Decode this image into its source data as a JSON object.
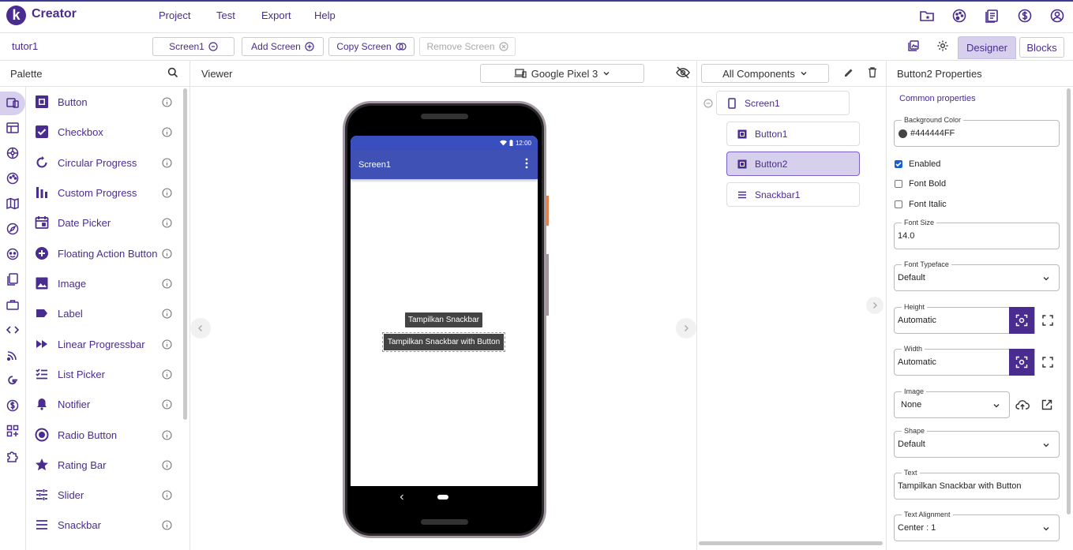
{
  "app": {
    "logo_letter": "k",
    "name": "Creator"
  },
  "menu": [
    "Project",
    "Test",
    "Export",
    "Help"
  ],
  "project": {
    "name": "tutor1"
  },
  "screen_bar": {
    "screen_select": "Screen1",
    "add_screen": "Add Screen",
    "copy_screen": "Copy Screen",
    "remove_screen": "Remove Screen",
    "designer": "Designer",
    "blocks": "Blocks"
  },
  "palette": {
    "title": "Palette",
    "items": [
      {
        "label": "Button",
        "icon": "button-icon"
      },
      {
        "label": "Checkbox",
        "icon": "checkbox-icon"
      },
      {
        "label": "Circular Progress",
        "icon": "circular-progress-icon"
      },
      {
        "label": "Custom Progress",
        "icon": "custom-progress-icon"
      },
      {
        "label": "Date Picker",
        "icon": "calendar-icon"
      },
      {
        "label": "Floating Action Button",
        "icon": "plus-circle-icon"
      },
      {
        "label": "Image",
        "icon": "image-icon"
      },
      {
        "label": "Label",
        "icon": "label-icon"
      },
      {
        "label": "Linear Progressbar",
        "icon": "fast-forward-icon"
      },
      {
        "label": "List Picker",
        "icon": "list-icon"
      },
      {
        "label": "Notifier",
        "icon": "bell-icon"
      },
      {
        "label": "Radio Button",
        "icon": "radio-icon"
      },
      {
        "label": "Rating Bar",
        "icon": "star-icon"
      },
      {
        "label": "Slider",
        "icon": "slider-icon"
      },
      {
        "label": "Snackbar",
        "icon": "snackbar-icon"
      }
    ]
  },
  "viewer": {
    "title": "Viewer",
    "device": "Google Pixel 3",
    "status_time": "12:00",
    "screen_title": "Screen1",
    "button1_text": "Tampilkan Snackbar",
    "button2_text": "Tampilkan Snackbar with Button"
  },
  "components": {
    "filter": "All Components",
    "tree": [
      {
        "label": "Screen1",
        "level": 0,
        "selected": false
      },
      {
        "label": "Button1",
        "level": 1,
        "selected": false
      },
      {
        "label": "Button2",
        "level": 1,
        "selected": true
      },
      {
        "label": "Snackbar1",
        "level": 1,
        "selected": false
      }
    ]
  },
  "properties": {
    "title": "Button2 Properties",
    "section": "Common properties",
    "background_color": {
      "label": "Background Color",
      "value": "#444444FF",
      "swatch": "#444444"
    },
    "enabled": {
      "label": "Enabled",
      "checked": true
    },
    "font_bold": {
      "label": "Font Bold",
      "checked": false
    },
    "font_italic": {
      "label": "Font Italic",
      "checked": false
    },
    "font_size": {
      "label": "Font Size",
      "value": "14.0"
    },
    "font_typeface": {
      "label": "Font Typeface",
      "value": "Default"
    },
    "height": {
      "label": "Height",
      "value": "Automatic"
    },
    "width": {
      "label": "Width",
      "value": "Automatic"
    },
    "image": {
      "label": "Image",
      "value": "None"
    },
    "shape": {
      "label": "Shape",
      "value": "Default"
    },
    "text": {
      "label": "Text",
      "value": "Tampilkan Snackbar with Button"
    },
    "text_alignment": {
      "label": "Text Alignment",
      "value": "Center : 1"
    }
  },
  "colors": {
    "accent": "#4a2c91",
    "selected_bg": "#d7d0ec",
    "app_bar": "#3f51b5"
  }
}
